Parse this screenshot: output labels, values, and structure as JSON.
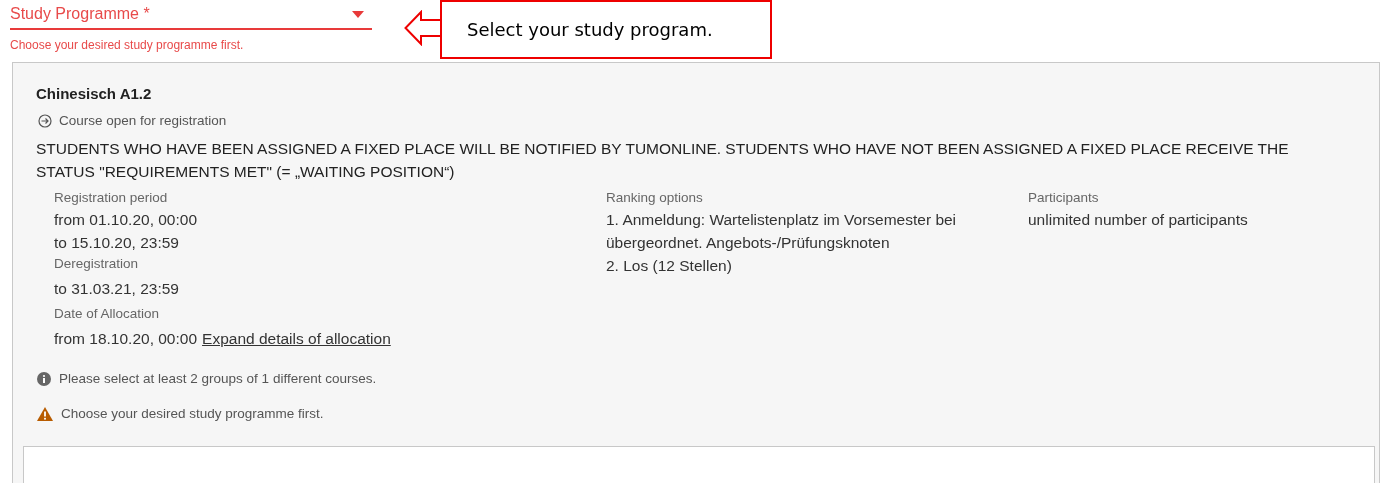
{
  "study_field": {
    "label": "Study Programme *",
    "error": "Choose your desired study programme first."
  },
  "callout": {
    "text": "Select your study program."
  },
  "course": {
    "title": "Chinesisch A1.2",
    "status": "Course open for registration",
    "notice": "STUDENTS WHO HAVE BEEN ASSIGNED A FIXED PLACE WILL BE NOTIFIED BY TUMONLINE. STUDENTS WHO HAVE NOT BEEN ASSIGNED A FIXED PLACE RECEIVE THE STATUS \"REQUIREMENTS MET\" (= „WAITING POSITION“)",
    "registration": {
      "label": "Registration period",
      "lines": [
        "from 01.10.20, 00:00",
        "to 15.10.20, 23:59"
      ]
    },
    "deregistration": {
      "label": "Deregistration",
      "lines": [
        "to 31.03.21, 23:59"
      ]
    },
    "allocation": {
      "label": "Date of Allocation",
      "value": "from 18.10.20, 00:00",
      "link": "Expand details of allocation"
    },
    "ranking": {
      "label": "Ranking options",
      "items": [
        "1. Anmeldung: Wartelistenplatz im Vorsemester bei übergeordnet. Angebots-/Prüfungsknoten",
        "2. Los (12 Stellen)"
      ]
    },
    "participants": {
      "label": "Participants",
      "value": "unlimited number of participants"
    },
    "messages": [
      {
        "kind": "info",
        "text": "Please select at least 2 groups of 1 different courses."
      },
      {
        "kind": "warning",
        "text": "Choose your desired study programme first."
      }
    ]
  }
}
